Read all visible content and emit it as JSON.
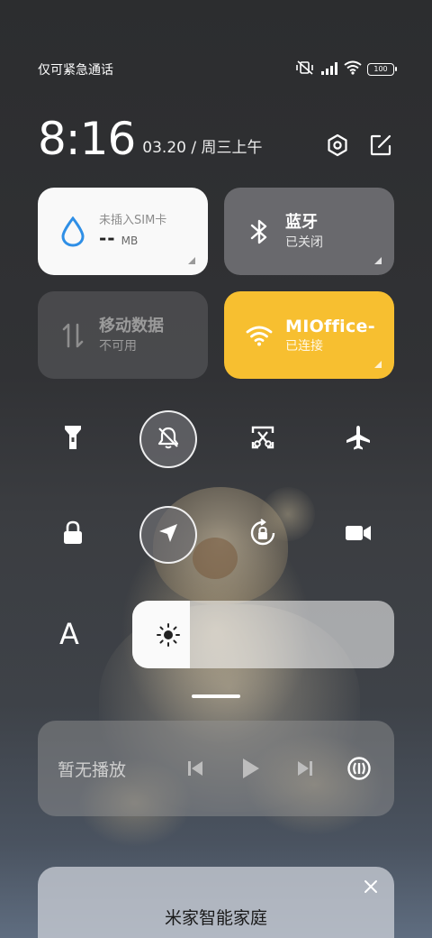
{
  "status_bar": {
    "carrier": "仅可紧急通话",
    "battery": "100",
    "icons": [
      "vibrate-off-icon",
      "signal-icon",
      "wifi-icon",
      "battery-icon"
    ]
  },
  "clock": {
    "time": "8:16",
    "date": "03.20 / 周三上午"
  },
  "header_actions": [
    "settings-icon",
    "edit-icon"
  ],
  "tiles": {
    "data": {
      "title": "未插入SIM卡",
      "value": "--",
      "unit": "MB",
      "icon": "water-drop-icon"
    },
    "bluetooth": {
      "title": "蓝牙",
      "status": "已关闭",
      "icon": "bluetooth-icon"
    },
    "mobile_data": {
      "title": "移动数据",
      "status": "不可用",
      "icon": "data-arrows-icon"
    },
    "wifi": {
      "title": "MIOffice-",
      "status": "已连接",
      "icon": "wifi-icon",
      "color": "#f7bf30"
    }
  },
  "toggles_row1": [
    "flashlight-icon",
    "mute-icon",
    "screenshot-icon",
    "airplane-icon"
  ],
  "toggles_row2": [
    "lock-icon",
    "location-icon",
    "rotation-lock-icon",
    "video-icon"
  ],
  "brightness": {
    "label": "A",
    "level_percent": 22
  },
  "media": {
    "label": "暂无播放"
  },
  "card": {
    "title": "米家智能家庭"
  },
  "accent_colors": {
    "wifi_tile": "#f7bf30",
    "data_tile": "#f9f9f9",
    "drop_icon": "#2f8fe6"
  }
}
